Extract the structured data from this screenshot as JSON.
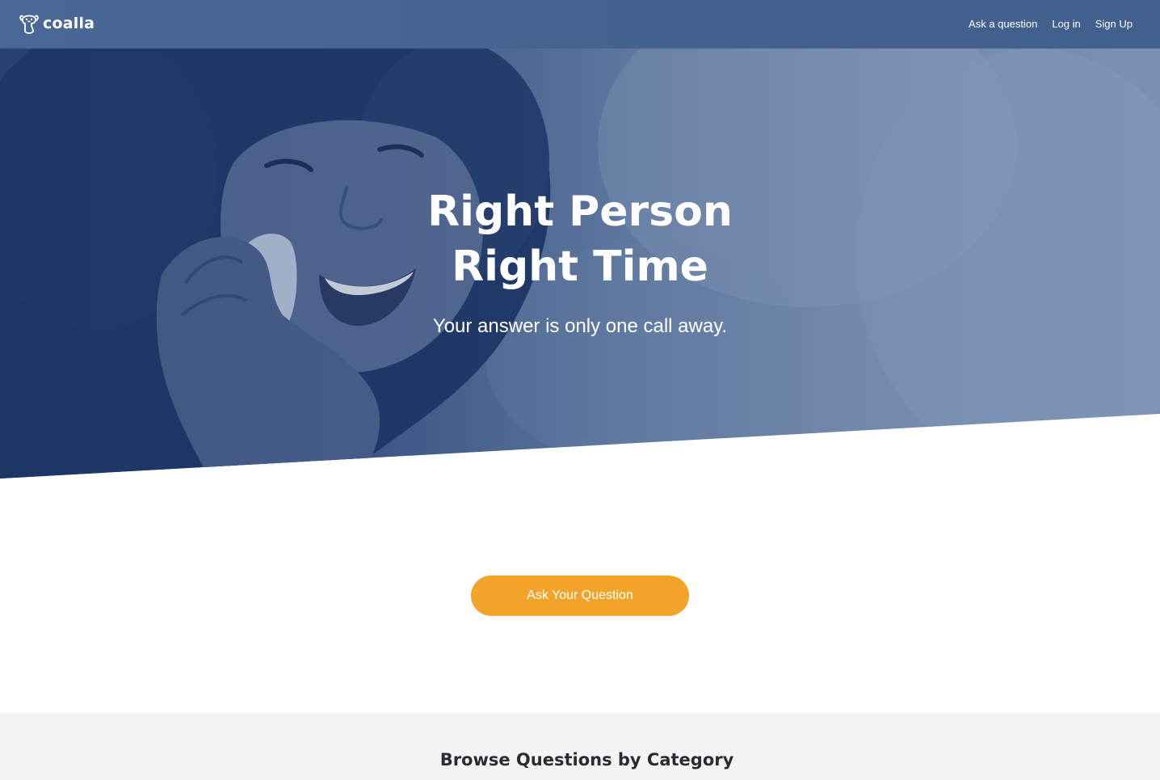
{
  "header": {
    "logo_text": "coalla",
    "nav": [
      {
        "label": "Ask a question"
      },
      {
        "label": "Log in"
      },
      {
        "label": "Sign Up"
      }
    ]
  },
  "hero": {
    "title_line1": "Right Person",
    "title_line2": "Right Time",
    "subtitle": "Your answer is only one call away."
  },
  "cta": {
    "label": "Ask Your Question"
  },
  "browse": {
    "heading": "Browse Questions by Category"
  },
  "colors": {
    "header_bg": "#46638f",
    "cta_bg": "#f2a42a",
    "section_bg": "#f4f4f4",
    "heading_text": "#2b2b33"
  }
}
